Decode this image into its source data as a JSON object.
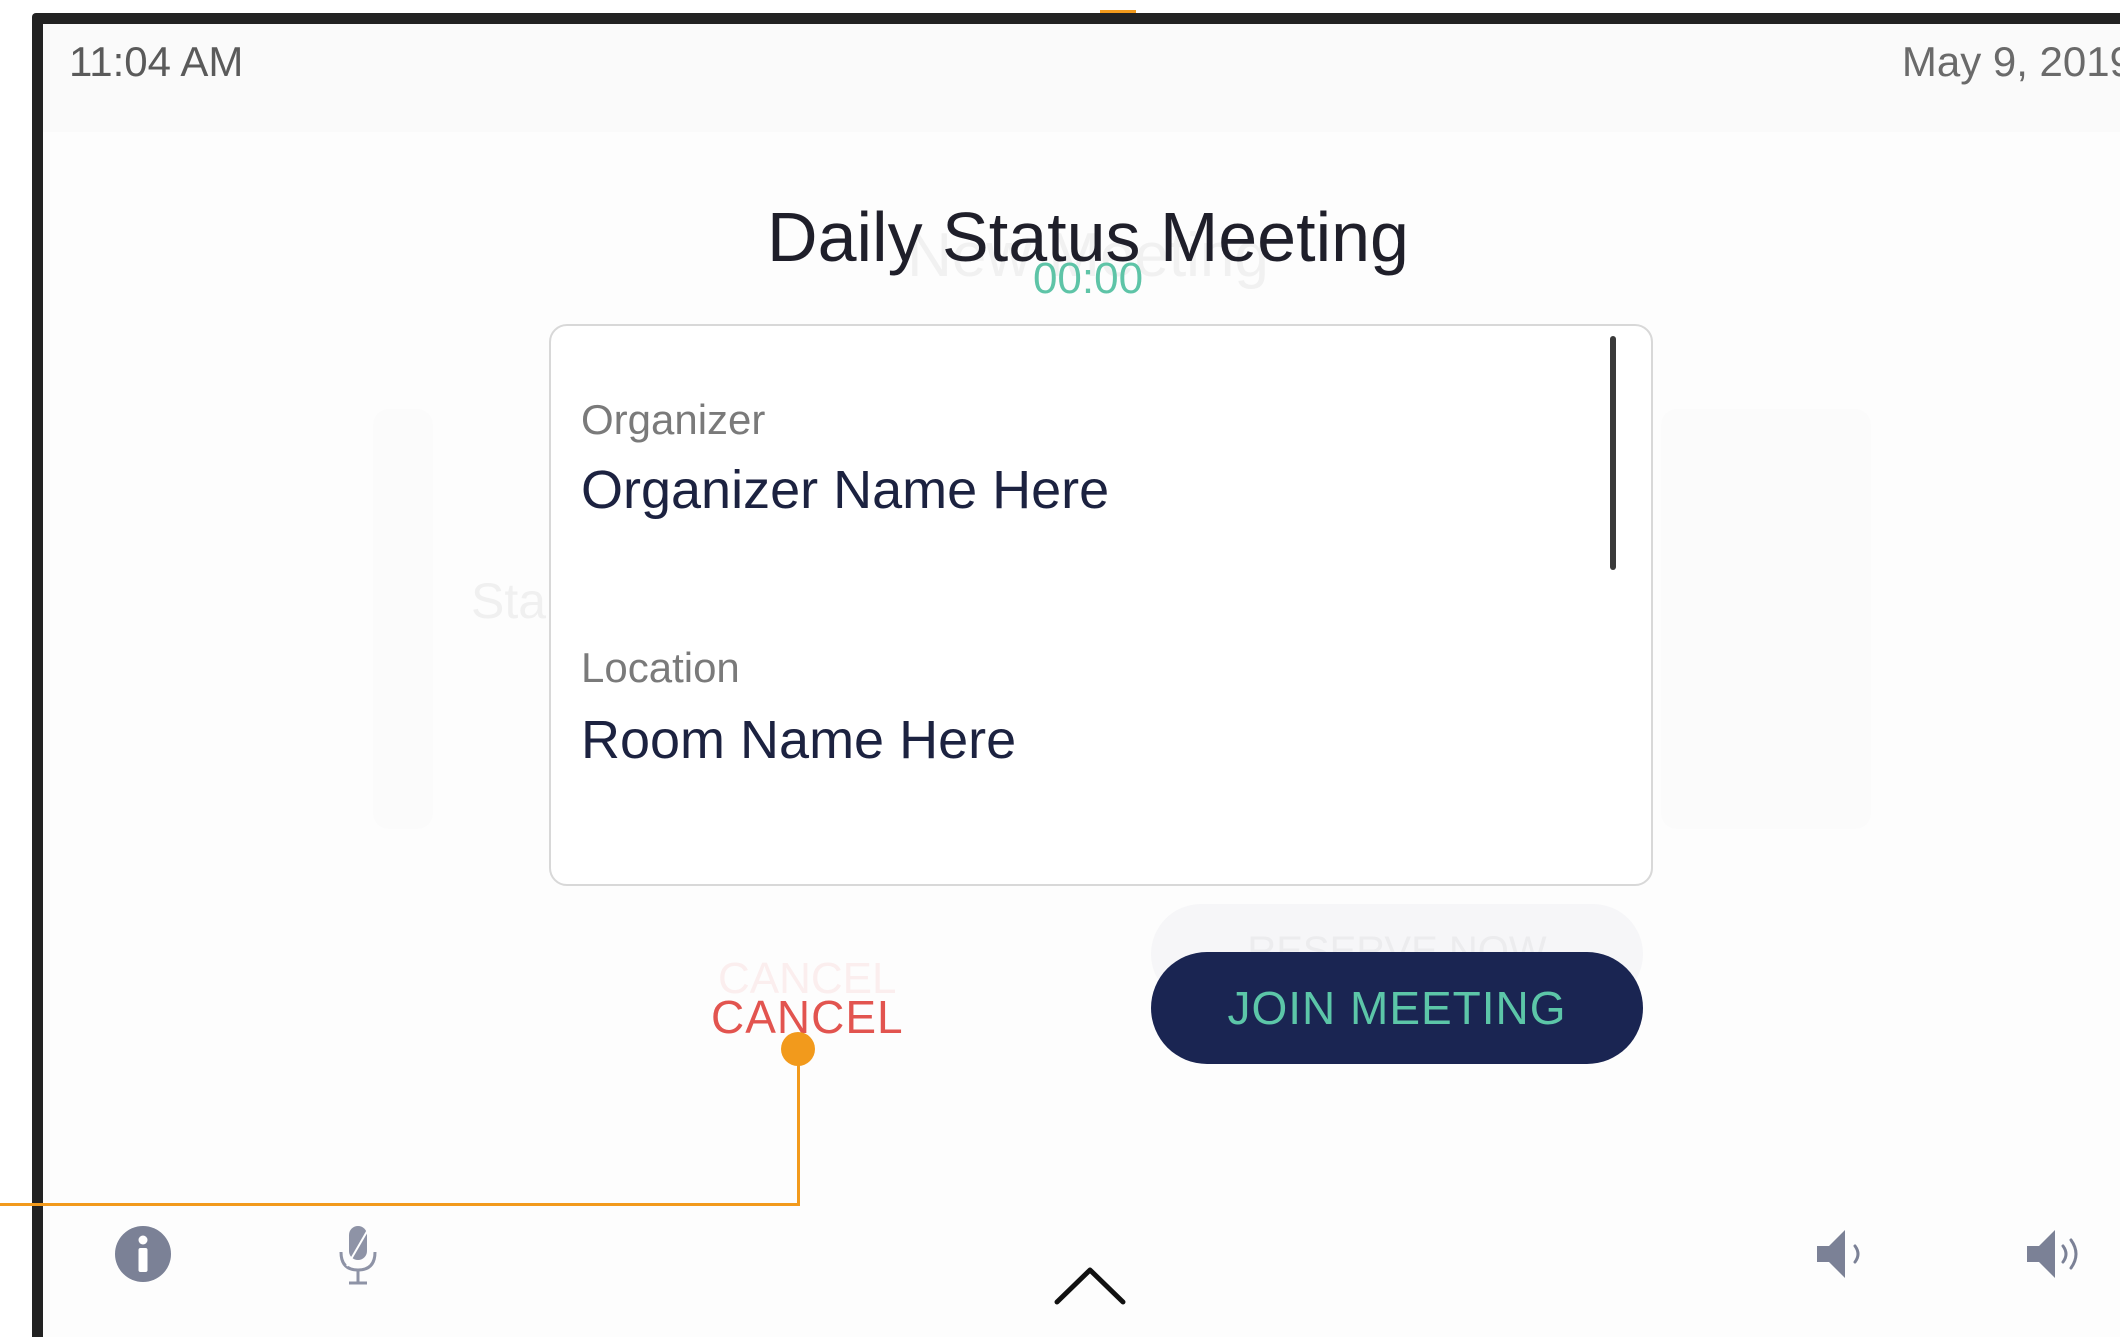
{
  "status_bar": {
    "time": "11:04 AM",
    "date": "May 9, 2019"
  },
  "background_screen": {
    "title": "New Meeting",
    "fragment": "Sta",
    "cancel_label": "CANCEL",
    "button_label": "RESERVE NOW"
  },
  "meeting": {
    "title": "Daily Status Meeting",
    "timer": "00:00",
    "organizer_label": "Organizer",
    "organizer_value": "Organizer Name Here",
    "location_label": "Location",
    "location_value": "Room Name Here"
  },
  "actions": {
    "cancel_label": "CANCEL",
    "join_label": "JOIN MEETING"
  },
  "toolbar": {
    "icons": [
      "info-icon",
      "microphone-icon",
      "chevron-up-icon",
      "volume-low-icon",
      "volume-high-icon"
    ]
  },
  "colors": {
    "accent_teal": "#5ec4a7",
    "navy": "#1a2552",
    "cancel_red": "#e2544f",
    "callout_orange": "#f29a1c",
    "icon_gray": "#7b8196"
  }
}
